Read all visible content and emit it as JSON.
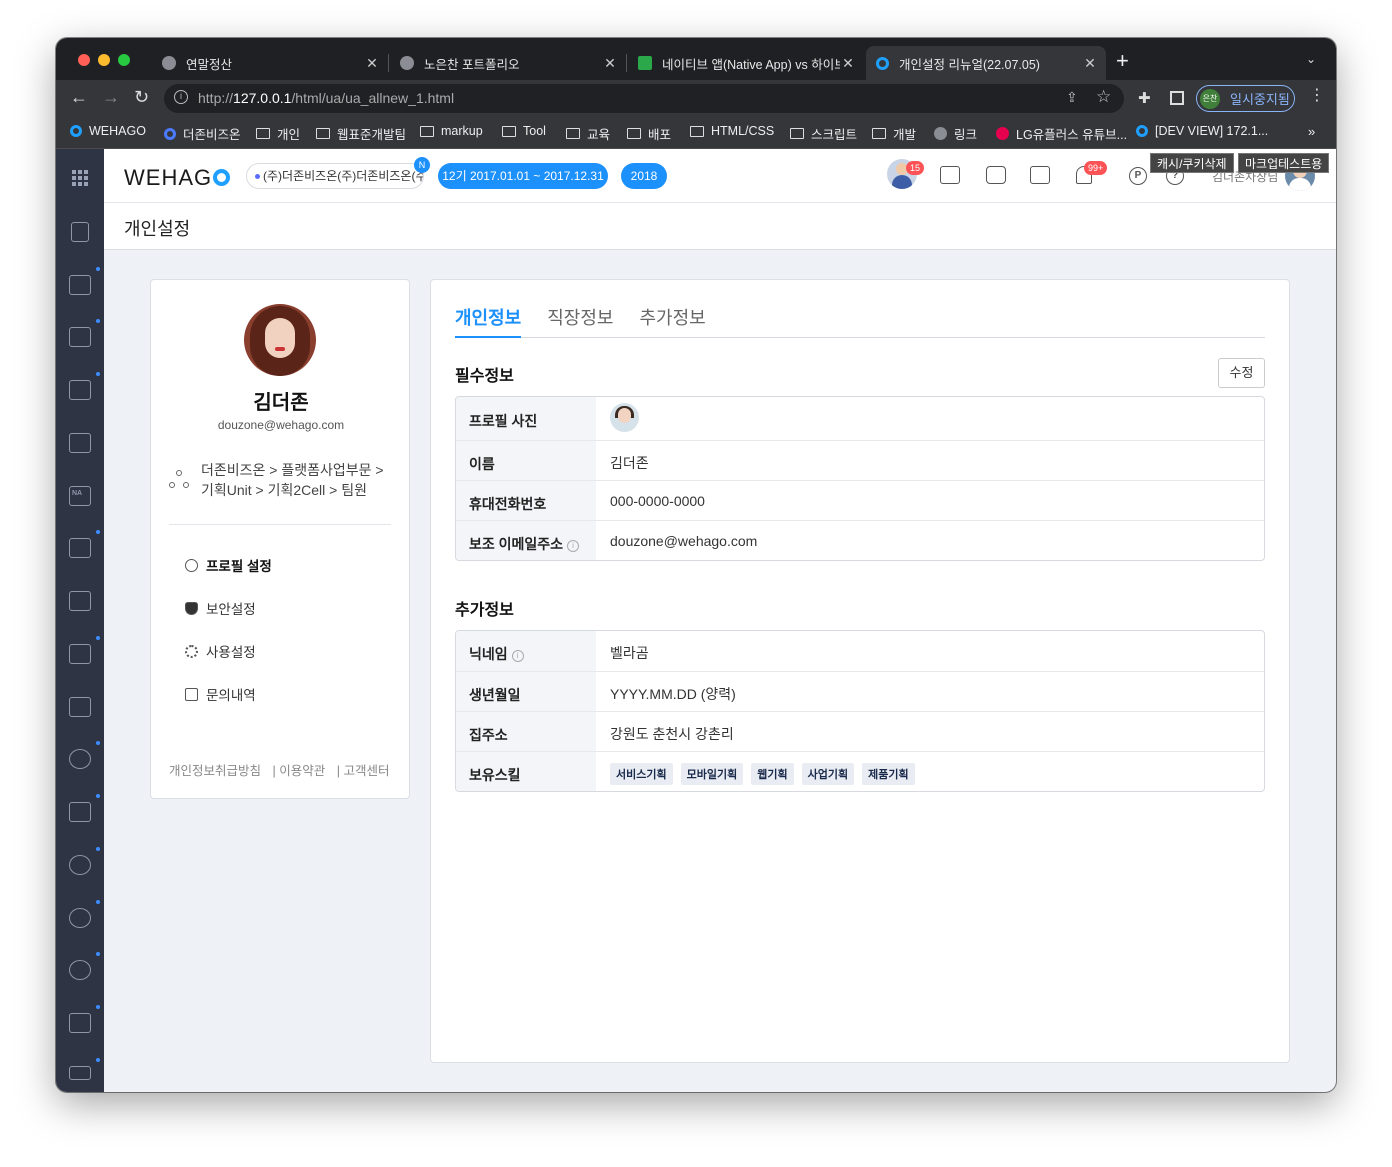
{
  "browser": {
    "tabs": [
      {
        "title": "연말정산"
      },
      {
        "title": "노은찬 포트폴리오"
      },
      {
        "title": "네이티브 앱(Native App) vs 하이브"
      },
      {
        "title": "개인설정 리뉴얼(22.07.05)"
      }
    ],
    "new_tab": "+",
    "url_prefix": "http://",
    "url_host": "127.0.0.1",
    "url_path": "/html/ua/ua_allnew_1.html",
    "profile_badge": "은찬",
    "profile_status": "일시중지됨",
    "bookmarks": [
      "WEHAGO",
      "더존비즈온",
      "개인",
      "웹표준개발팀",
      "markup",
      "Tool",
      "교육",
      "배포",
      "HTML/CSS",
      "스크립트",
      "개발",
      "링크",
      "LG유플러스 유튜브...",
      "[DEV VIEW] 172.1..."
    ],
    "bookmarks_more": "»"
  },
  "gnb": {
    "logo": "WEHAG",
    "company": "(주)더존비즈온(주)더존비즈온(주)더존비즈온",
    "company_badge": "N",
    "period": "12기 2017.01.01 ~ 2017.12.31",
    "year": "2018",
    "avatar_count": "15",
    "bell_count": "99+",
    "user_name": "김더존차장님",
    "overlay_buttons": [
      "캐시/쿠키삭제",
      "마크업테스트용"
    ]
  },
  "page": {
    "title": "개인설정"
  },
  "profile": {
    "name": "김더존",
    "email": "douzone@wehago.com",
    "org_line1": "더존비즈온 > 플랫폼사업부문 >",
    "org_line2": "기획Unit > 기획2Cell > 팀원",
    "menu": [
      {
        "label": "프로필 설정",
        "active": true
      },
      {
        "label": "보안설정",
        "active": false
      },
      {
        "label": "사용설정",
        "active": false
      },
      {
        "label": "문의내역",
        "active": false
      }
    ],
    "footer": [
      "개인정보취급방침",
      "| 이용약관",
      "| 고객센터"
    ]
  },
  "detail": {
    "tabs": [
      {
        "label": "개인정보",
        "active": true
      },
      {
        "label": "직장정보",
        "active": false
      },
      {
        "label": "추가정보",
        "active": false
      }
    ],
    "required_title": "필수정보",
    "edit_button": "수정",
    "required_rows": [
      {
        "label": "프로필 사진",
        "value": ""
      },
      {
        "label": "이름",
        "value": "김더존"
      },
      {
        "label": "휴대전화번호",
        "value": "000-0000-0000"
      },
      {
        "label": "보조 이메일주소",
        "value": "douzone@wehago.com"
      }
    ],
    "extra_title": "추가정보",
    "extra_rows": [
      {
        "label": "닉네임",
        "value": "벨라곰"
      },
      {
        "label": "생년월일",
        "value": "YYYY.MM.DD (양력)"
      },
      {
        "label": "집주소",
        "value": "강원도 춘천시 강촌리"
      },
      {
        "label": "보유스킬",
        "value": ""
      }
    ],
    "skills": [
      "서비스기획",
      "모바일기획",
      "웹기획",
      "사업기획",
      "제품기획"
    ]
  },
  "colors": {
    "accent": "#1c90fb",
    "lnb": "#2e3444",
    "alert": "#fc5356"
  }
}
